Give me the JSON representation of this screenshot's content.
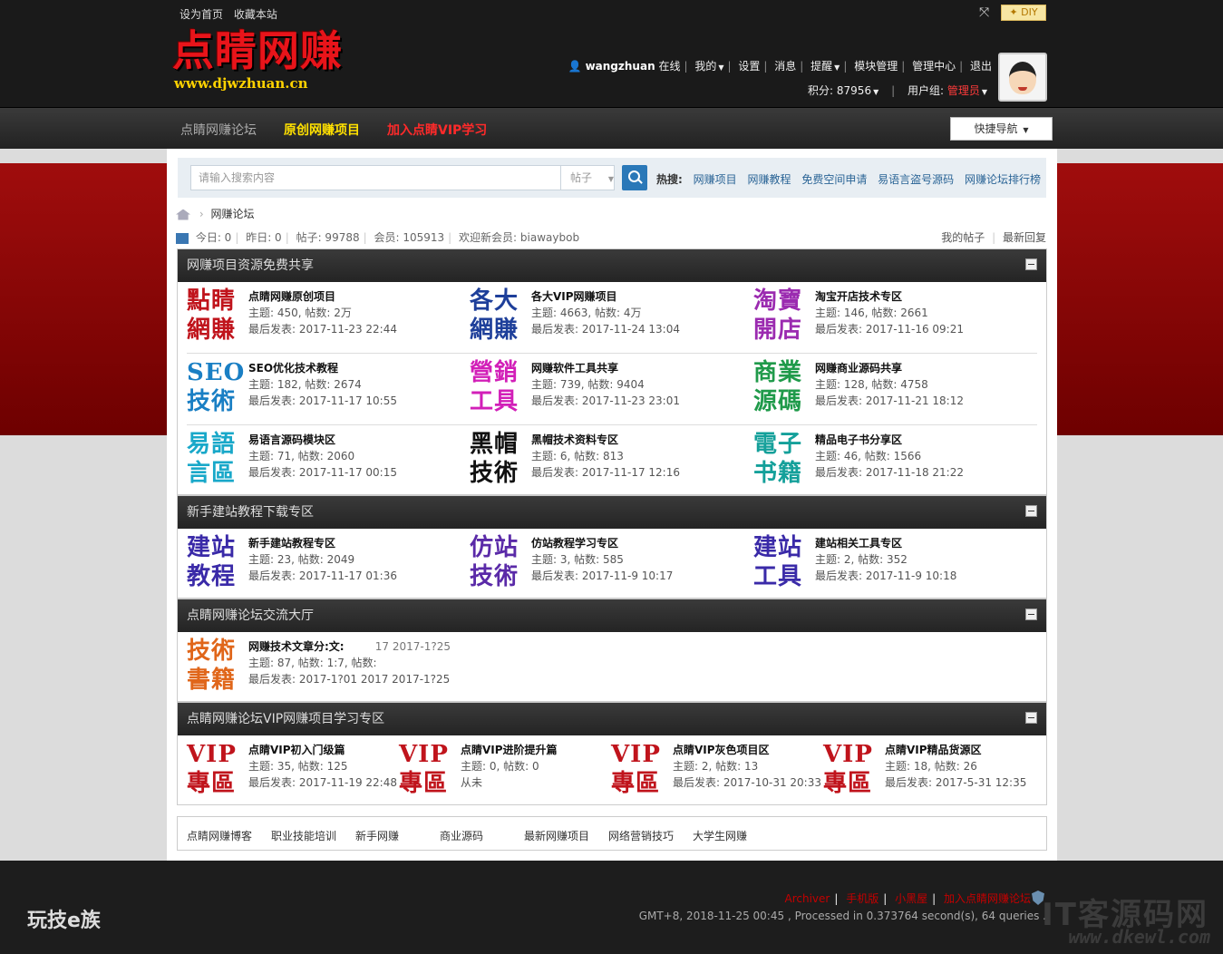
{
  "top": {
    "set_home": "设为首页",
    "bookmark": "收藏本站",
    "diy": "DIY"
  },
  "logo": {
    "cn": "点睛网赚",
    "url": "www.djwzhuan.cn"
  },
  "user": {
    "name": "wangzhuan",
    "online": "在线",
    "mine": "我的",
    "settings": "设置",
    "messages": "消息",
    "remind": "提醒",
    "module_manage": "模块管理",
    "admin_center": "管理中心",
    "logout": "退出",
    "points": "积分: 87956",
    "group_label": "用户组:",
    "group": "管理员"
  },
  "nav": {
    "item1": "点睛网赚论坛",
    "item2": "原创网赚项目",
    "item3": "加入点睛VIP学习",
    "quick": "快捷导航"
  },
  "search": {
    "placeholder": "请输入搜索内容",
    "type": "帖子",
    "hot_label": "热搜:",
    "hot": [
      "网赚项目",
      "网赚教程",
      "免费空间申请",
      "易语言盗号源码",
      "网赚论坛排行榜"
    ]
  },
  "breadcrumb": {
    "label": "网赚论坛"
  },
  "stats": {
    "today": "今日: 0",
    "yesterday": "昨日: 0",
    "posts": "帖子: 99788",
    "members": "会员: 105913",
    "welcome": "欢迎新会员: biawaybob",
    "my_posts": "我的帖子",
    "latest": "最新回复"
  },
  "categories": [
    {
      "title": "网赚项目资源免费共享",
      "forums": [
        {
          "icon1": "點睛",
          "icon2": "網賺",
          "color": "#c0141c",
          "name": "点睛网赚原创项目",
          "meta": "主题: 450, 帖数: 2万",
          "last": "最后发表: 2017-11-23 22:44"
        },
        {
          "icon1": "各大",
          "icon2": "網賺",
          "color": "#1e3f9a",
          "name": "各大VIP网赚项目",
          "meta": "主题: 4663, 帖数: 4万",
          "last": "最后发表: 2017-11-24 13:04"
        },
        {
          "icon1": "淘寶",
          "icon2": "開店",
          "color": "#9b2bb0",
          "name": "淘宝开店技术专区",
          "meta": "主题: 146, 帖数: 2661",
          "last": "最后发表: 2017-11-16 09:21"
        },
        {
          "icon1": "SEO",
          "icon2": "技術",
          "color": "#1a7fc4",
          "name": "SEO优化技术教程",
          "meta": "主题: 182, 帖数: 2674",
          "last": "最后发表: 2017-11-17 10:55"
        },
        {
          "icon1": "營銷",
          "icon2": "工具",
          "color": "#d21fb8",
          "name": "网赚软件工具共享",
          "meta": "主题: 739, 帖数: 9404",
          "last": "最后发表: 2017-11-23 23:01"
        },
        {
          "icon1": "商業",
          "icon2": "源碼",
          "color": "#1f9a4a",
          "name": "网赚商业源码共享",
          "meta": "主题: 128, 帖数: 4758",
          "last": "最后发表: 2017-11-21 18:12"
        },
        {
          "icon1": "易語",
          "icon2": "言區",
          "color": "#19a8c9",
          "name": "易语言源码模块区",
          "meta": "主题: 71, 帖数: 2060",
          "last": "最后发表: 2017-11-17 00:15"
        },
        {
          "icon1": "黑帽",
          "icon2": "技術",
          "color": "#111111",
          "name": "黑帽技术资料专区",
          "meta": "主题: 6, 帖数: 813",
          "last": "最后发表: 2017-11-17 12:16"
        },
        {
          "icon1": "電子",
          "icon2": "书籍",
          "color": "#14a09a",
          "name": "精品电子书分享区",
          "meta": "主题: 46, 帖数: 1566",
          "last": "最后发表: 2017-11-18 21:22"
        }
      ]
    },
    {
      "title": "新手建站教程下载专区",
      "forums": [
        {
          "icon1": "建站",
          "icon2": "教程",
          "color": "#3a2aa8",
          "name": "新手建站教程专区",
          "meta": "主题: 23, 帖数: 2049",
          "last": "最后发表: 2017-11-17 01:36"
        },
        {
          "icon1": "仿站",
          "icon2": "技術",
          "color": "#5a2aa8",
          "name": "仿站教程学习专区",
          "meta": "主题: 3, 帖数: 585",
          "last": "最后发表: 2017-11-9 10:17"
        },
        {
          "icon1": "建站",
          "icon2": "工具",
          "color": "#3a2aa8",
          "name": "建站相关工具专区",
          "meta": "主题: 2, 帖数: 352",
          "last": "最后发表: 2017-11-9 10:18"
        }
      ]
    },
    {
      "title": "点睛网赚论坛交流大厅",
      "forums": [
        {
          "icon1": "技術",
          "icon2": "書籍",
          "color": "#e0661a",
          "name": "网赚技术文章分:文:",
          "meta": "主题: 87, 帖数: 1:7, 帖数:",
          "last": "最后发表: 2017-1?01 2017 2017-1?25",
          "extra": "17 2017-1?25"
        }
      ]
    },
    {
      "title": "点睛网赚论坛VIP网赚项目学习专区",
      "forums": [
        {
          "icon1": "VIP",
          "icon2": "專區",
          "color": "#c0141c",
          "name": "点睛VIP初入门级篇",
          "meta": "主题: 35, 帖数: 125",
          "last": "最后发表: 2017-11-19 22:48"
        },
        {
          "icon1": "VIP",
          "icon2": "專區",
          "color": "#c0141c",
          "name": "点睛VIP进阶提升篇",
          "meta": "主题: 0, 帖数: 0",
          "last": "从未"
        },
        {
          "icon1": "VIP",
          "icon2": "專區",
          "color": "#c0141c",
          "name": "点睛VIP灰色项目区",
          "meta": "主题: 2, 帖数: 13",
          "last": "最后发表: 2017-10-31 20:33"
        },
        {
          "icon1": "VIP",
          "icon2": "專區",
          "color": "#c0141c",
          "name": "点睛VIP精品货源区",
          "meta": "主题: 18, 帖数: 26",
          "last": "最后发表: 2017-5-31 12:35"
        }
      ]
    }
  ],
  "friend_links": [
    "点睛网赚博客",
    "职业技能培训",
    "新手网赚",
    "商业源码",
    "最新网赚项目",
    "网络营销技巧",
    "大学生网赚"
  ],
  "footer": {
    "logo": "玩技e族",
    "links": [
      "Archiver",
      "手机版",
      "小黑屋",
      "加入点睛网赚论坛"
    ],
    "gmt": "GMT+8, 2018-11-25 00:45 , Processed in 0.373764 second(s), 64 queries .",
    "watermark": "IT客源码网",
    "watermark_url": "www.dkewl.com"
  }
}
